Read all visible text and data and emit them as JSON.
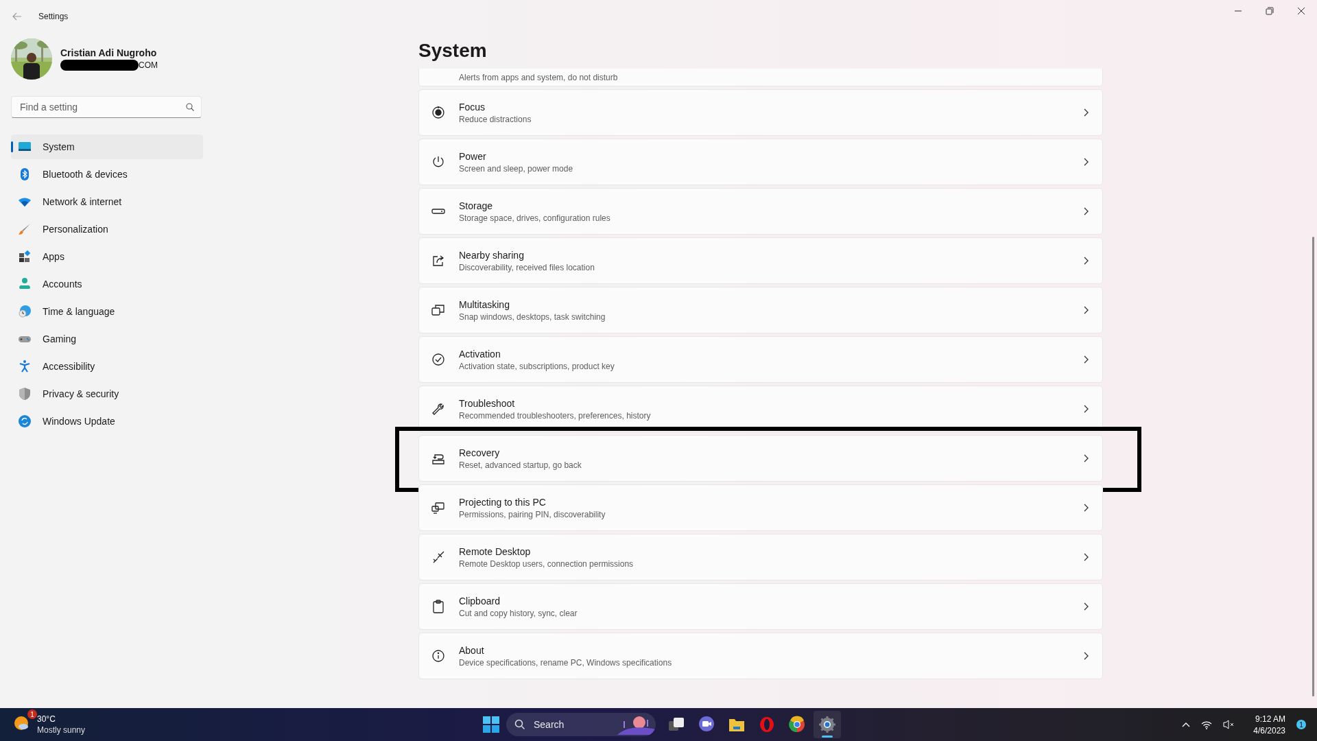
{
  "window": {
    "title": "Settings"
  },
  "profile": {
    "name": "Cristian Adi Nugroho",
    "email_visible": "COM"
  },
  "search": {
    "placeholder": "Find a setting"
  },
  "sidebar": {
    "items": [
      {
        "label": "System",
        "selected": true
      },
      {
        "label": "Bluetooth & devices",
        "selected": false
      },
      {
        "label": "Network & internet",
        "selected": false
      },
      {
        "label": "Personalization",
        "selected": false
      },
      {
        "label": "Apps",
        "selected": false
      },
      {
        "label": "Accounts",
        "selected": false
      },
      {
        "label": "Time & language",
        "selected": false
      },
      {
        "label": "Gaming",
        "selected": false
      },
      {
        "label": "Accessibility",
        "selected": false
      },
      {
        "label": "Privacy & security",
        "selected": false
      },
      {
        "label": "Windows Update",
        "selected": false
      }
    ]
  },
  "page": {
    "title": "System",
    "partial_item": {
      "description": "Alerts from apps and system, do not disturb"
    },
    "items": [
      {
        "title": "Focus",
        "description": "Reduce distractions",
        "highlighted": false
      },
      {
        "title": "Power",
        "description": "Screen and sleep, power mode",
        "highlighted": false
      },
      {
        "title": "Storage",
        "description": "Storage space, drives, configuration rules",
        "highlighted": false
      },
      {
        "title": "Nearby sharing",
        "description": "Discoverability, received files location",
        "highlighted": false
      },
      {
        "title": "Multitasking",
        "description": "Snap windows, desktops, task switching",
        "highlighted": false
      },
      {
        "title": "Activation",
        "description": "Activation state, subscriptions, product key",
        "highlighted": false
      },
      {
        "title": "Troubleshoot",
        "description": "Recommended troubleshooters, preferences, history",
        "highlighted": false
      },
      {
        "title": "Recovery",
        "description": "Reset, advanced startup, go back",
        "highlighted": true
      },
      {
        "title": "Projecting to this PC",
        "description": "Permissions, pairing PIN, discoverability",
        "highlighted": false
      },
      {
        "title": "Remote Desktop",
        "description": "Remote Desktop users, connection permissions",
        "highlighted": false
      },
      {
        "title": "Clipboard",
        "description": "Cut and copy history, sync, clear",
        "highlighted": false
      },
      {
        "title": "About",
        "description": "Device specifications, rename PC, Windows specifications",
        "highlighted": false
      }
    ]
  },
  "taskbar": {
    "weather": {
      "badge": "1",
      "temperature": "30°C",
      "condition": "Mostly sunny"
    },
    "search": {
      "placeholder": "Search"
    },
    "apps": [
      {
        "selected": false
      },
      {
        "selected": false
      },
      {
        "selected": false
      },
      {
        "selected": false
      },
      {
        "selected": false
      },
      {
        "selected": true
      }
    ],
    "clock": {
      "time": "9:12 AM",
      "date": "4/6/2023"
    },
    "notification_count": "1"
  }
}
